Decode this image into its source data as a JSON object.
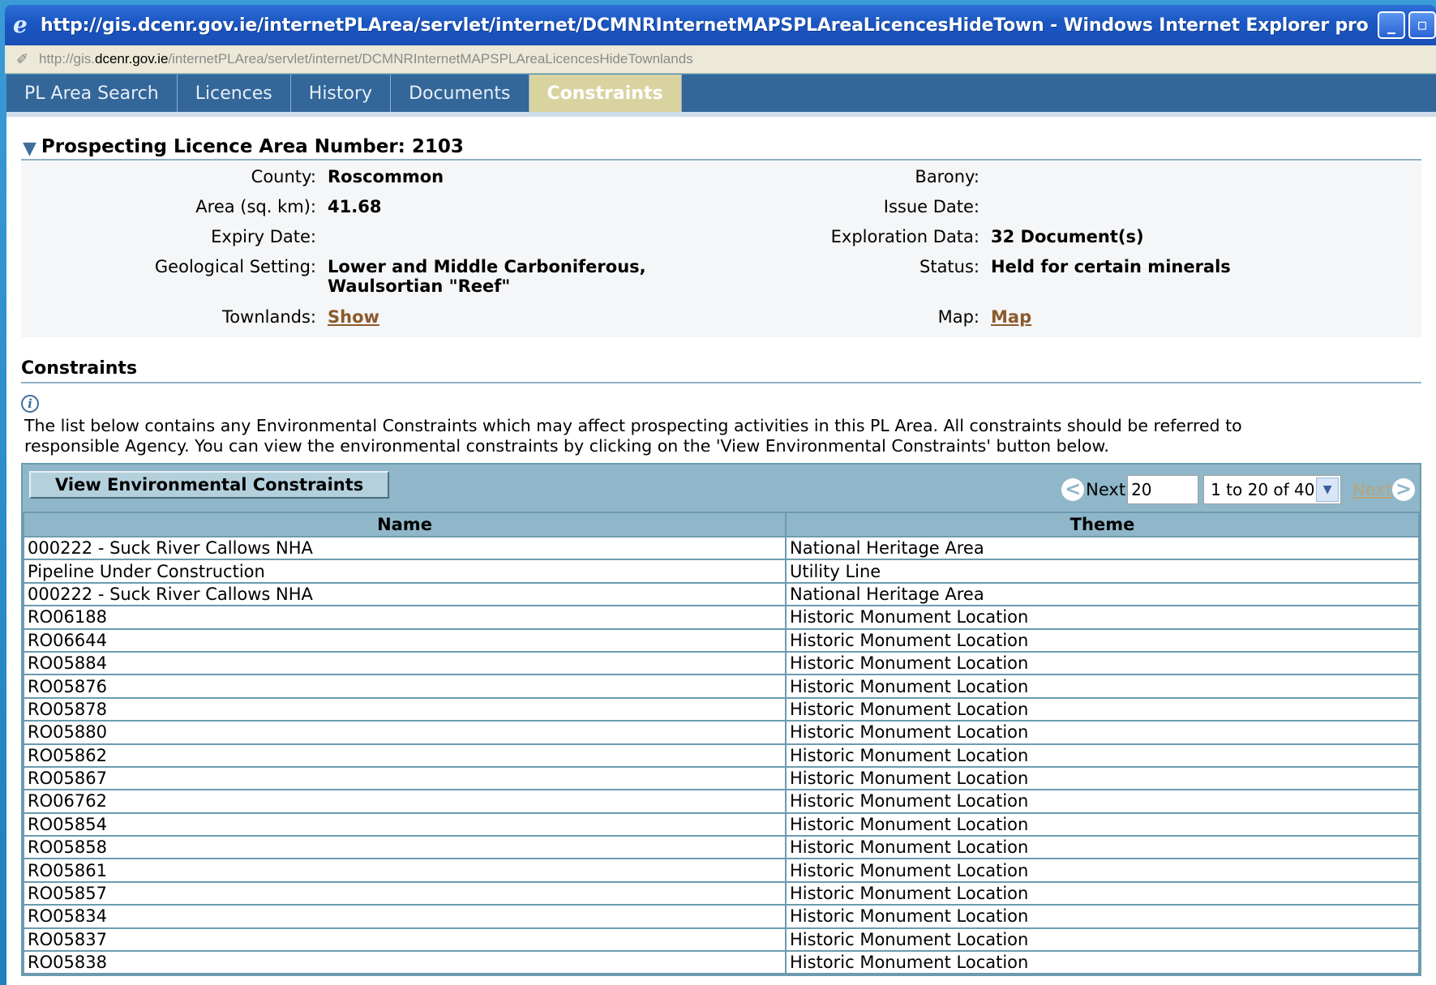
{
  "window": {
    "title": "http://gis.dcenr.gov.ie/internetPLArea/servlet/internet/DCMNRInternetMAPSPLAreaLicencesHideTown - Windows Internet Explorer pro",
    "url_prefix": "http://gis.",
    "url_domain": "dcenr.gov.ie",
    "url_path": "/internetPLArea/servlet/internet/DCMNRInternetMAPSPLAreaLicencesHideTownlands"
  },
  "tabs": [
    {
      "label": "PL Area Search"
    },
    {
      "label": "Licences"
    },
    {
      "label": "History"
    },
    {
      "label": "Documents"
    },
    {
      "label": "Constraints",
      "active": true
    }
  ],
  "details": {
    "title": "Prospecting Licence Area Number: 2103",
    "county_label": "County:",
    "county_value": "Roscommon",
    "area_label": "Area (sq. km):",
    "area_value": "41.68",
    "expiry_label": "Expiry Date:",
    "expiry_value": "",
    "geo_label": "Geological Setting:",
    "geo_value_1": "Lower and Middle Carboniferous,",
    "geo_value_2": "Waulsortian \"Reef\"",
    "townlands_label": "Townlands:",
    "townlands_link": "Show",
    "barony_label": "Barony:",
    "barony_value": "",
    "issue_label": "Issue Date:",
    "issue_value": "",
    "exploration_label": "Exploration Data:",
    "exploration_value": "32 Document(s)",
    "status_label": "Status:",
    "status_value": "Held for certain minerals",
    "map_label": "Map:",
    "map_link": "Map"
  },
  "constraints": {
    "title": "Constraints",
    "info_text_1": "The list below contains any Environmental Constraints which may affect prospecting activities in this PL Area. All constraints should be referred to",
    "info_text_2": "responsible Agency. You can view the environmental constraints by clicking on the 'View Environmental Constraints' button below.",
    "view_button": "View Environmental Constraints",
    "pager": {
      "prev_label": "Next",
      "page_size": "20",
      "range": "1 to 20 of 40",
      "next_label": "Next"
    },
    "columns": [
      "Name",
      "Theme"
    ],
    "rows": [
      [
        "000222 - Suck River Callows NHA",
        "National Heritage Area"
      ],
      [
        "Pipeline Under Construction",
        "Utility Line"
      ],
      [
        "000222 - Suck River Callows NHA",
        "National Heritage Area"
      ],
      [
        "RO06188",
        "Historic Monument Location"
      ],
      [
        "RO06644",
        "Historic Monument Location"
      ],
      [
        "RO05884",
        "Historic Monument Location"
      ],
      [
        "RO05876",
        "Historic Monument Location"
      ],
      [
        "RO05878",
        "Historic Monument Location"
      ],
      [
        "RO05880",
        "Historic Monument Location"
      ],
      [
        "RO05862",
        "Historic Monument Location"
      ],
      [
        "RO05867",
        "Historic Monument Location"
      ],
      [
        "RO06762",
        "Historic Monument Location"
      ],
      [
        "RO05854",
        "Historic Monument Location"
      ],
      [
        "RO05858",
        "Historic Monument Location"
      ],
      [
        "RO05861",
        "Historic Monument Location"
      ],
      [
        "RO05857",
        "Historic Monument Location"
      ],
      [
        "RO05834",
        "Historic Monument Location"
      ],
      [
        "RO05837",
        "Historic Monument Location"
      ],
      [
        "RO05838",
        "Historic Monument Location"
      ]
    ]
  }
}
